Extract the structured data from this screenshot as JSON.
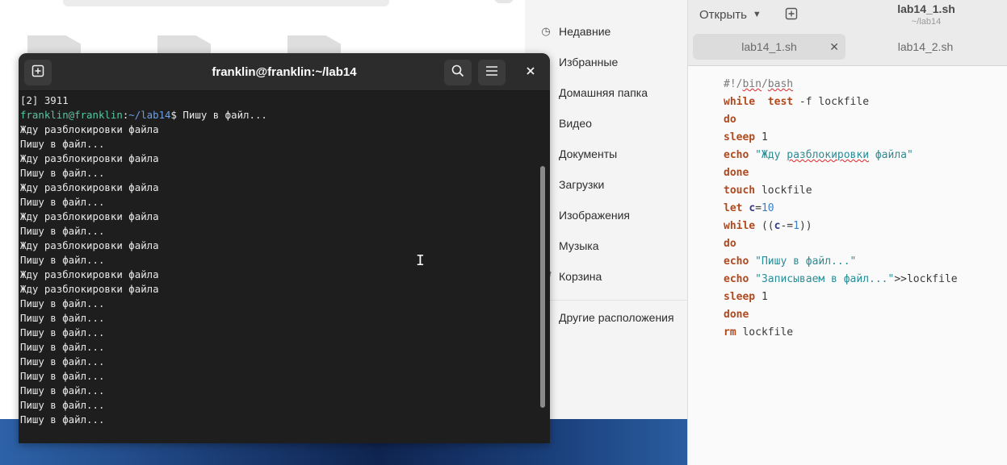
{
  "files": {
    "sidebar": [
      {
        "icon": "clock-icon",
        "label": "Недавние"
      },
      {
        "icon": "star-icon",
        "label": "Избранные"
      },
      {
        "icon": "home-icon",
        "label": "Домашняя папка"
      },
      {
        "icon": "video-icon",
        "label": "Видео"
      },
      {
        "icon": "document-icon",
        "label": "Документы"
      },
      {
        "icon": "download-icon",
        "label": "Загрузки"
      },
      {
        "icon": "image-icon",
        "label": "Изображения"
      },
      {
        "icon": "music-icon",
        "label": "Музыка"
      },
      {
        "icon": "trash-icon",
        "label": "Корзина"
      },
      {
        "icon": "plus-icon",
        "label": "Другие расположения"
      }
    ]
  },
  "terminal": {
    "title": "franklin@franklin:~/lab14",
    "prompt_user": "franklin@franklin",
    "prompt_path": "~/lab14",
    "prompt_suffix": "$ ",
    "lines": [
      "[2] 3911",
      "PROMPT|Пишу в файл...",
      "Жду разблокировки файла",
      "Пишу в файл...",
      "Жду разблокировки файла",
      "Пишу в файл...",
      "Жду разблокировки файла",
      "Пишу в файл...",
      "Жду разблокировки файла",
      "Пишу в файл...",
      "Жду разблокировки файла",
      "Пишу в файл...",
      "Жду разблокировки файла",
      "Жду разблокировки файла",
      "Пишу в файл...",
      "Пишу в файл...",
      "Пишу в файл...",
      "Пишу в файл...",
      "Пишу в файл...",
      "Пишу в файл...",
      "Пишу в файл...",
      "Пишу в файл...",
      "Пишу в файл..."
    ]
  },
  "editor": {
    "open_label": "Открыть",
    "title": "lab14_1.sh",
    "subtitle": "~/lab14",
    "tabs": [
      {
        "label": "lab14_1.sh",
        "active": true
      },
      {
        "label": "lab14_2.sh",
        "active": false
      }
    ],
    "code": [
      [
        [
          "cm",
          "#!/"
        ],
        [
          "cm spell",
          "bin"
        ],
        [
          "cm",
          "/"
        ],
        [
          "cm spell",
          "bash"
        ]
      ],
      [
        [
          "kw",
          "while"
        ],
        [
          "",
          "  "
        ],
        [
          "kw",
          "test"
        ],
        [
          "",
          " -f lockfile"
        ]
      ],
      [
        [
          "kw",
          "do"
        ]
      ],
      [
        [
          "kw",
          "sleep"
        ],
        [
          "",
          " 1"
        ]
      ],
      [
        [
          "kw",
          "echo"
        ],
        [
          "str",
          " \"Жду "
        ],
        [
          "str spell",
          "разблокировки"
        ],
        [
          "str",
          " файла\""
        ]
      ],
      [
        [
          "kw",
          "done"
        ]
      ],
      [
        [
          "kw",
          "touch"
        ],
        [
          "",
          " lockfile"
        ]
      ],
      [
        [
          "kw",
          "let"
        ],
        [
          "",
          " "
        ],
        [
          "var",
          "c"
        ],
        [
          "",
          "="
        ],
        [
          "num",
          "10"
        ]
      ],
      [
        [
          "kw",
          "while"
        ],
        [
          "",
          " (("
        ],
        [
          "var",
          "c"
        ],
        [
          "",
          "-="
        ],
        [
          "num",
          "1"
        ],
        [
          "",
          "))"
        ]
      ],
      [
        [
          "kw",
          "do"
        ]
      ],
      [
        [
          "kw",
          "echo"
        ],
        [
          "str",
          " \"Пишу в файл...\""
        ]
      ],
      [
        [
          "kw",
          "echo"
        ],
        [
          "str",
          " \"Записываем в файл...\""
        ],
        [
          "",
          ">>lockfile"
        ]
      ],
      [
        [
          "kw",
          "sleep"
        ],
        [
          "",
          " 1"
        ]
      ],
      [
        [
          "kw",
          "done"
        ]
      ],
      [
        [
          "kw",
          "rm"
        ],
        [
          "",
          " lockfile"
        ]
      ]
    ]
  }
}
